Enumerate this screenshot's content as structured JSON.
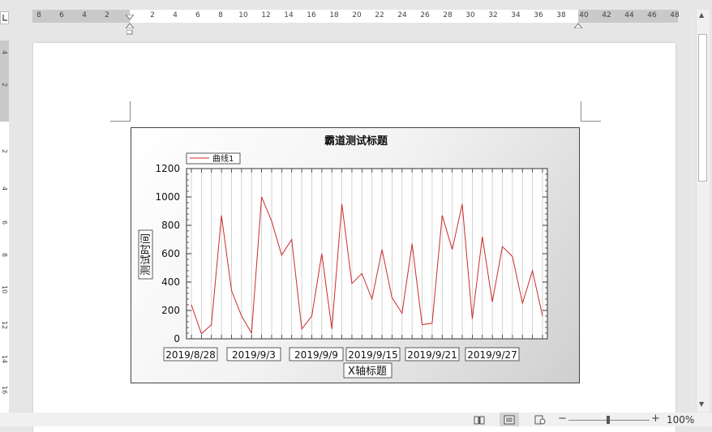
{
  "ruler": {
    "left_labels": [
      "8",
      "6",
      "4",
      "2"
    ],
    "main_labels": [
      "2",
      "4",
      "6",
      "8",
      "10",
      "12",
      "14",
      "16",
      "18",
      "20",
      "22",
      "24",
      "26",
      "28",
      "30",
      "32",
      "34",
      "36",
      "38",
      "40",
      "42",
      "44",
      "46",
      "48"
    ],
    "vertical_labels": [
      "4",
      "2",
      "2",
      "4",
      "6",
      "8",
      "10",
      "12",
      "14",
      "16"
    ]
  },
  "chart_data": {
    "type": "line",
    "title": "霸道测试标题",
    "xlabel": "X轴标题",
    "ylabel": "测试时间",
    "ylim": [
      0,
      1200
    ],
    "yticks": [
      "0",
      "200",
      "400",
      "600",
      "800",
      "1000",
      "1200"
    ],
    "x_tick_labels": [
      "2019/8/28",
      "2019/9/3",
      "2019/9/9",
      "2019/9/15",
      "2019/9/21",
      "2019/9/27"
    ],
    "legend": "top-left",
    "grid": "vertical",
    "series": [
      {
        "name": "曲线1",
        "color": "#cc2b2b",
        "values": [
          240,
          35,
          100,
          870,
          340,
          160,
          40,
          1000,
          830,
          590,
          700,
          70,
          160,
          600,
          70,
          950,
          390,
          460,
          280,
          630,
          290,
          180,
          670,
          100,
          110,
          870,
          630,
          950,
          140,
          720,
          260,
          650,
          580,
          250,
          480,
          160
        ]
      }
    ]
  },
  "status": {
    "zoom_minus": "−",
    "zoom_plus": "+",
    "zoom_level": "100%"
  }
}
